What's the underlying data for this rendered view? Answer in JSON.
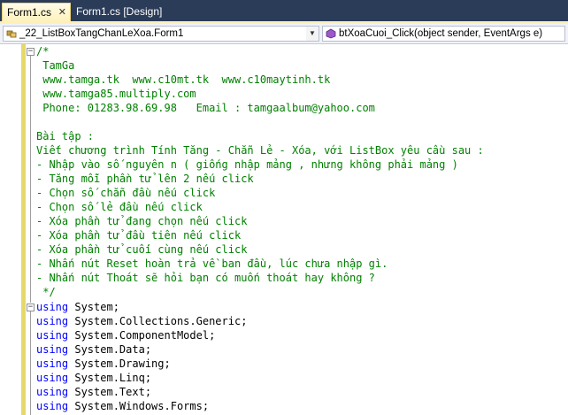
{
  "tabs": [
    {
      "label": "Form1.cs",
      "active": true
    },
    {
      "label": "Form1.cs [Design]",
      "active": false
    }
  ],
  "navbar": {
    "type_combo": "_22_ListBoxTangChanLeXoa.Form1",
    "member_combo": "btXoaCuoi_Click(object sender, EventArgs e)"
  },
  "code": {
    "comment_lines": [
      "/*",
      " TamGa",
      " www.tamga.tk  www.c10mt.tk  www.c10maytinh.tk",
      " www.tamga85.multiply.com",
      " Phone: 01283.98.69.98   Email : tamgaalbum@yahoo.com",
      "",
      "Bài tập :",
      "Viết chương trình Tính Tăng - Chẵn Lẻ - Xóa, với ListBox yêu cầu sau :",
      "- Nhập vào số nguyên n ( giống nhập mảng , nhưng không phải mảng )",
      "- Tăng mỗi phần tử lên 2 nếu click",
      "- Chọn số chẵn đầu nếu click",
      "- Chọn số lẻ đầu nếu click",
      "- Xóa phần tử đang chọn nếu click",
      "- Xóa phần tử đầu tiên nếu click",
      "- Xóa phần tử cuối cùng nếu click",
      "- Nhấn nút Reset hoàn trả về ban đầu, lúc chưa nhập gì.",
      "- Nhấn nút Thoát sẽ hỏi bạn có muốn thoát hay không ?",
      " */"
    ],
    "using_keyword": "using",
    "using_lines": [
      " System;",
      " System.Collections.Generic;",
      " System.ComponentModel;",
      " System.Data;",
      " System.Drawing;",
      " System.Linq;",
      " System.Text;",
      " System.Windows.Forms;"
    ]
  },
  "colors": {
    "comment": "#008000",
    "keyword": "#0000ff",
    "tab_strip": "#2b3c59"
  },
  "icons": {
    "type_combo": "class-icon",
    "member_combo": "method-icon",
    "tab_close": "close-icon"
  }
}
